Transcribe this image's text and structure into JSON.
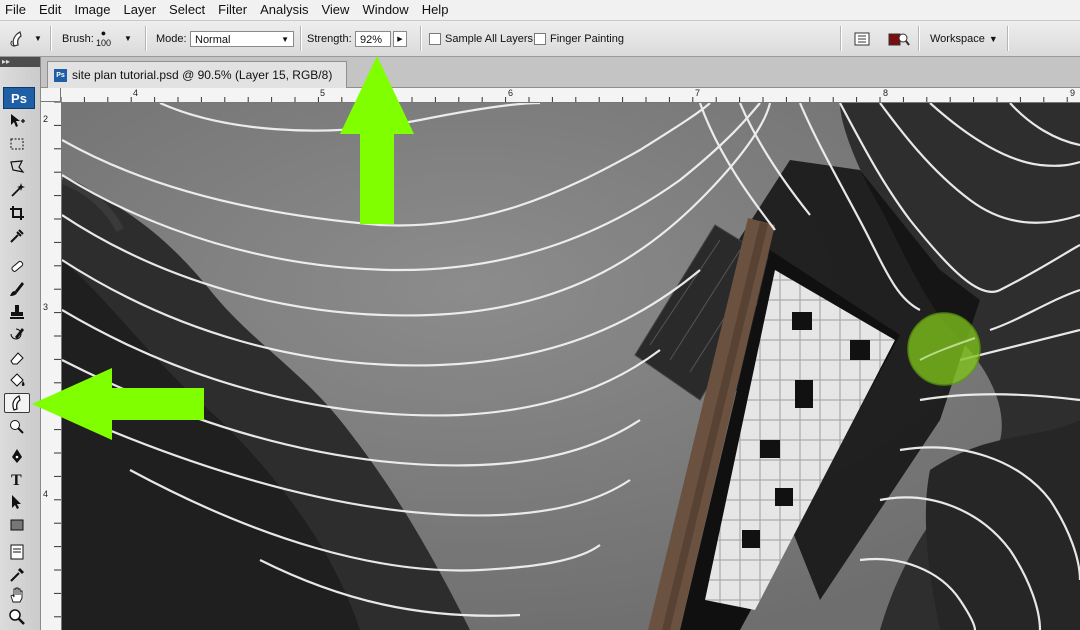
{
  "menu": [
    "File",
    "Edit",
    "Image",
    "Layer",
    "Select",
    "Filter",
    "Analysis",
    "View",
    "Window",
    "Help"
  ],
  "options": {
    "brush_label": "Brush:",
    "brush_size": "100",
    "mode_label": "Mode:",
    "mode_value": "Normal",
    "strength_label": "Strength:",
    "strength_value": "92%",
    "sample_all_layers": "Sample All Layers",
    "finger_painting": "Finger Painting",
    "workspace": "Workspace"
  },
  "toolbox": {
    "logo": "Ps",
    "active_tool": "smudge-tool"
  },
  "document": {
    "tab_title": "site plan tutorial.psd @ 90.5% (Layer 15, RGB/8)",
    "tab_icon_text": "Ps"
  },
  "rulers": {
    "top": [
      "4",
      "5",
      "6",
      "7",
      "8",
      "9"
    ],
    "left": [
      "2",
      "3",
      "4"
    ]
  },
  "annotations": {
    "arrow_color": "#80ff00",
    "highlight_color": "#7fc31c"
  }
}
